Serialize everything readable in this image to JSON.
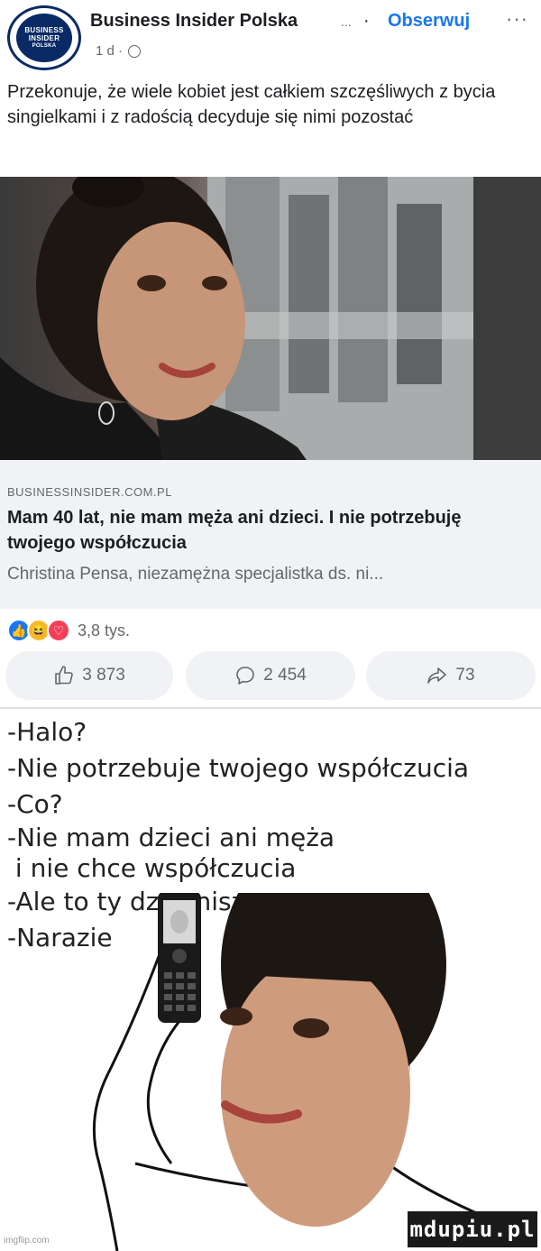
{
  "post": {
    "page_name": "Business Insider Polska",
    "name_ellipsis": "...",
    "separator": "·",
    "follow_label": "Obserwuj",
    "more_label": "···",
    "time": "1 d ·",
    "avatar_text": [
      "BUSINESS",
      "INSIDER",
      "POLSKA"
    ],
    "text": "Przekonuje, że wiele kobiet jest całkiem szczęśliwych z bycia singielkami i z radością decyduje się nimi pozostać"
  },
  "link": {
    "domain": "BUSINESSINSIDER.COM.PL",
    "title": "Mam 40 lat, nie mam męża ani dzieci. I nie potrzebuję twojego współczucia",
    "description": "Christina Pensa, niezamężna specjalistka ds. ni..."
  },
  "reactions": {
    "icons": [
      "like-icon",
      "haha-icon",
      "love-icon"
    ],
    "count": "3,8 tys."
  },
  "actions": {
    "like_count": "3 873",
    "comment_count": "2 454",
    "share_count": "73"
  },
  "dialog": [
    "-Halo?",
    "-Nie potrzebuje twojego współczucia",
    "-Co?",
    "-Nie mam dzieci ani męża",
    " i nie chce współczucia",
    "-Ale to ty dzwonisz.",
    "-Narazie"
  ],
  "watermarks": {
    "left": "imgflip.com",
    "right": "mdupiu.pl"
  },
  "colors": {
    "accent": "#1877f2",
    "link_box": "#f0f2f5",
    "muted_text": "#65676b"
  }
}
